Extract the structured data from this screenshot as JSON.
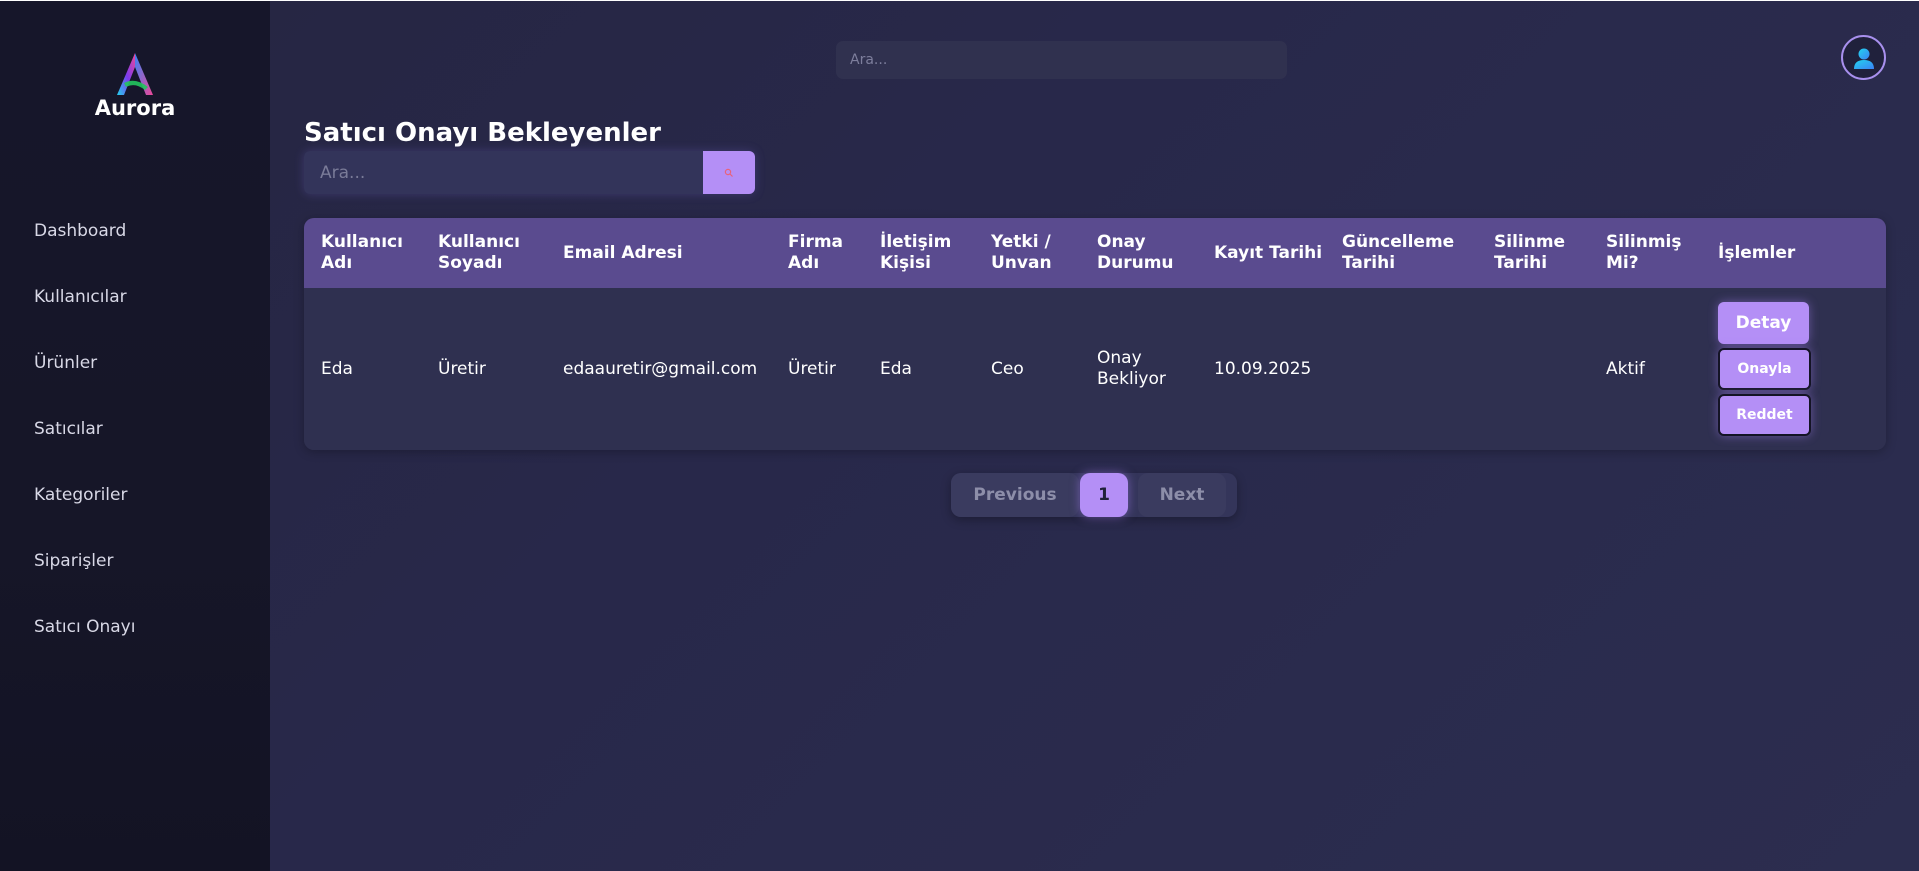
{
  "brand": {
    "name": "Aurora"
  },
  "sidebar": {
    "items": [
      {
        "label": "Dashboard"
      },
      {
        "label": "Kullanıcılar"
      },
      {
        "label": "Ürünler"
      },
      {
        "label": "Satıcılar"
      },
      {
        "label": "Kategoriler"
      },
      {
        "label": "Siparişler"
      },
      {
        "label": "Satıcı Onayı"
      }
    ]
  },
  "header": {
    "search_placeholder": "Ara...",
    "avatar_icon": "user-icon"
  },
  "main": {
    "title": "Satıcı Onayı Bekleyenler",
    "search_placeholder": "Ara...",
    "search_icon": "search-icon",
    "table": {
      "columns": [
        "Kullanıcı Adı",
        "Kullanıcı Soyadı",
        "Email Adresi",
        "Firma Adı",
        "İletişim Kişisi",
        "Yetki / Unvan",
        "Onay Durumu",
        "Kayıt Tarihi",
        "Güncelleme Tarihi",
        "Silinme Tarihi",
        "Silinmiş Mi?",
        "İşlemler"
      ],
      "rows": [
        {
          "cells": [
            "Eda",
            "Üretir",
            "edaauretir@gmail.com",
            "Üretir",
            "Eda",
            "Ceo",
            "Onay Bekliyor",
            "10.09.2025",
            "",
            "",
            "Aktif"
          ],
          "actions": {
            "detail": "Detay",
            "approve": "Onayla",
            "reject": "Reddet"
          }
        }
      ]
    },
    "pagination": {
      "previous": "Previous",
      "current_page": "1",
      "next": "Next"
    }
  },
  "colors": {
    "accent": "#b48ff6",
    "header_row": "#5a4b8f",
    "sidebar_bg": "#16162a",
    "main_bg": "#28284a"
  }
}
